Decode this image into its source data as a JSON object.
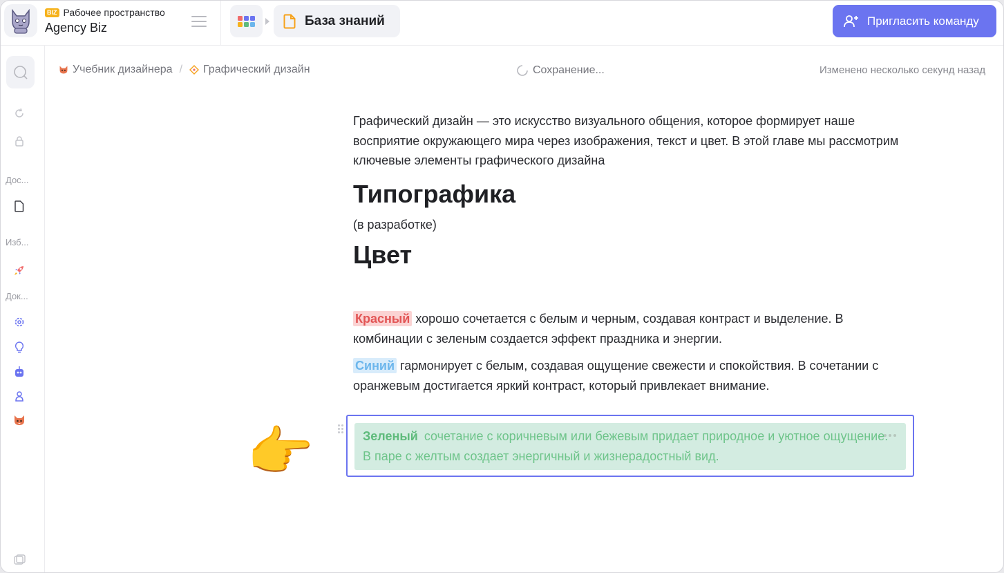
{
  "workspace": {
    "badge": "BIZ",
    "label": "Рабочее пространство",
    "name": "Agency Biz"
  },
  "header": {
    "knowledge_base_title": "База знаний",
    "invite_button": "Пригласить команду"
  },
  "rail": {
    "sections": [
      "Дос...",
      "Изб...",
      "Док..."
    ]
  },
  "breadcrumb": {
    "items": [
      "Учебник дизайнера",
      "Графический дизайн"
    ],
    "separator": "/"
  },
  "status": {
    "saving": "Сохранение...",
    "modified": "Изменено несколько секунд назад"
  },
  "document": {
    "intro": "Графический дизайн — это искусство визуального общения, которое формирует наше восприятие окружающего мира через изображения, текст и цвет. В этой главе мы рассмотрим ключевые элементы графического дизайна",
    "h_typography": "Типографика",
    "typography_note": "(в разработке)",
    "h_color": "Цвет",
    "red_word": "Красный",
    "red_text": " хорошо сочетается с белым и черным, создавая контраст и выделение. В комбинации с зеленым создается эффект праздника и энергии.",
    "blue_word": "Синий",
    "blue_text": " гармонирует с белым, создавая ощущение свежести и спокойствия. В сочетании с оранжевым достигается яркий контраст, который привлекает внимание.",
    "green_word": "Зеленый",
    "green_text": "сочетание с коричневым или бежевым придает природное и уютное ощущение. В паре с желтым создает энергичный и жизнерадостный вид."
  },
  "colors": {
    "accent": "#6b74f0",
    "red_highlight": "#fbd3d3",
    "blue_highlight": "#d8ecfb",
    "green_highlight": "#d3ece1"
  },
  "icons": {
    "pointer": "👉"
  }
}
